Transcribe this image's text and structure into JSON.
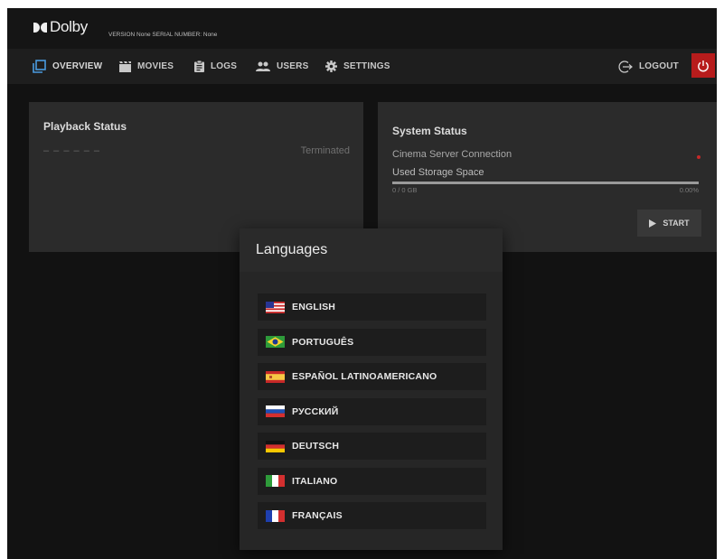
{
  "header": {
    "brand": "Dolby",
    "version_line": "VERSION None SERIAL NUMBER: None"
  },
  "nav": {
    "items": [
      {
        "label": "OVERVIEW",
        "icon": "overview-icon"
      },
      {
        "label": "MOVIES",
        "icon": "clapperboard-icon"
      },
      {
        "label": "LOGS",
        "icon": "clipboard-icon"
      },
      {
        "label": "USERS",
        "icon": "users-icon"
      },
      {
        "label": "SETTINGS",
        "icon": "gear-icon"
      }
    ],
    "logout_label": "LOGOUT",
    "power_icon": "power-icon"
  },
  "playback": {
    "title": "Playback Status",
    "placeholder": "– – – – – –",
    "state": "Terminated"
  },
  "system": {
    "title": "System Status",
    "connection_label": "Cinema Server Connection",
    "connection_status_color": "#c62828",
    "storage_label": "Used Storage Space",
    "storage_amount": "0 / 0 GB",
    "storage_percent": "0.00%",
    "storage_fraction": 0.0,
    "start_label": "START"
  },
  "dialog": {
    "title": "Languages",
    "languages": [
      {
        "label": "ENGLISH",
        "flag": "us-flag-icon"
      },
      {
        "label": "PORTUGUÊS",
        "flag": "brazil-flag-icon"
      },
      {
        "label": "ESPAÑOL LATINOAMERICANO",
        "flag": "spain-flag-icon"
      },
      {
        "label": "РУССКИЙ",
        "flag": "russia-flag-icon"
      },
      {
        "label": "DEUTSCH",
        "flag": "germany-flag-icon"
      },
      {
        "label": "ITALIANO",
        "flag": "italy-flag-icon"
      },
      {
        "label": "FRANÇAIS",
        "flag": "france-flag-icon"
      }
    ]
  },
  "colors": {
    "background": "#121212",
    "card": "#2b2b2b",
    "accent_red": "#b71c1c"
  }
}
